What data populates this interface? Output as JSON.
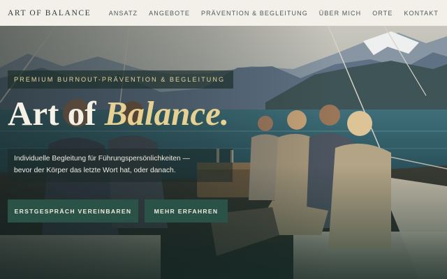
{
  "header": {
    "brand": "ART OF BALANCE",
    "nav": [
      "ANSATZ",
      "ANGEBOTE",
      "PRÄVENTION & BEGLEITUNG",
      "ÜBER MICH",
      "ORTE",
      "KONTAKT"
    ]
  },
  "hero": {
    "tagline": "PREMIUM BURNOUT-PRÄVENTION & BEGLEITUNG",
    "headline_main": "Art of",
    "headline_accent": "Balance.",
    "lede_line1": "Individuelle Begleitung für Führungspersönlichkeiten —",
    "lede_line2": "bevor der Körper das letzte Wort hat, oder danach.",
    "cta_primary": "ERSTGESPRÄCH VEREINBAREN",
    "cta_secondary": "MEHR ERFAHREN"
  },
  "colors": {
    "header_bg": "#f3f0ea",
    "accent_gold": "#e6d092",
    "button_green": "#2a5247",
    "lake": "#2e5a66",
    "mountains": "#5f7184"
  },
  "image": {
    "description_icon": "hero-photo-yacht-group-lake-mountains"
  }
}
